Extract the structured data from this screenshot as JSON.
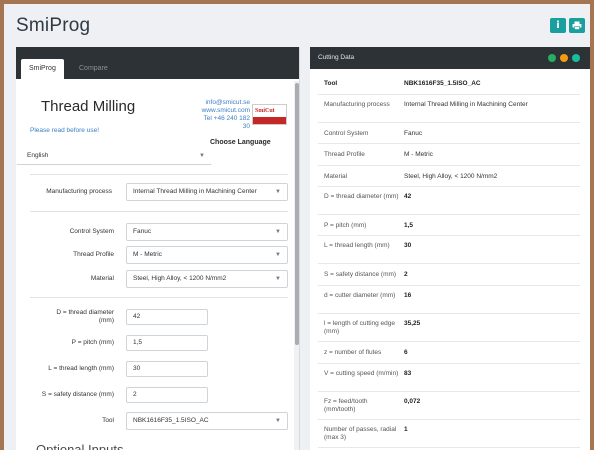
{
  "header": {
    "app_title": "SmiProg",
    "info_icon": "info-icon",
    "print_icon": "print-icon"
  },
  "left": {
    "tabs": [
      {
        "label": "SmiProg"
      },
      {
        "label": "Compare"
      }
    ],
    "heading": "Thread Milling",
    "read_link": "Please read before use!",
    "contact": {
      "email": "info@smicut.se",
      "web": "www.smicut.com",
      "tel1": "Tel +46 240 182",
      "tel2": "30"
    },
    "logo_text": "SmiCut",
    "choose_language": "Choose Language",
    "language": "English",
    "manufacturing_process": {
      "label": "Manufacturing process",
      "value": "Internal Thread Milling in Machining Center"
    },
    "control_system": {
      "label": "Control System",
      "value": "Fanuc"
    },
    "thread_profile": {
      "label": "Thread Profile",
      "value": "M - Metric"
    },
    "material": {
      "label": "Material",
      "value": "Steel, High Alloy, < 1200 N/mm2"
    },
    "diameter": {
      "label_1": "D = thread diameter",
      "label_2": "(mm)",
      "value": "42"
    },
    "pitch": {
      "label": "P = pitch (mm)",
      "value": "1,5"
    },
    "length": {
      "label": "L = thread length (mm)",
      "value": "30"
    },
    "safety": {
      "label": "S = safety distance (mm)",
      "value": "2"
    },
    "tool": {
      "label": "Tool",
      "value": "NBK1616F35_1.5ISO_AC"
    },
    "optional_heading": "Optional Inputs"
  },
  "right": {
    "header_title": "Cutting Data",
    "rows": [
      {
        "label": "Tool",
        "value": "NBK1616F35_1.5ISO_AC",
        "bold": true
      },
      {
        "label": "Manufacturing process",
        "value": "Internal Thread Milling in Machining Center",
        "bold": false
      },
      {
        "label": "Control System",
        "value": "Fanuc",
        "bold": false
      },
      {
        "label": "Thread Profile",
        "value": "M - Metric",
        "bold": false
      },
      {
        "label": "Material",
        "value": "Steel, High Alloy, < 1200 N/mm2",
        "bold": false
      },
      {
        "label": "D = thread diameter (mm)",
        "value": "42",
        "bold": true
      },
      {
        "label": "P = pitch (mm)",
        "value": "1,5",
        "bold": true
      },
      {
        "label": "L = thread length (mm)",
        "value": "30",
        "bold": true
      },
      {
        "label": "S = safety distance (mm)",
        "value": "2",
        "bold": true
      },
      {
        "label": "d = cutter diameter (mm)",
        "value": "16",
        "bold": true
      },
      {
        "label": "l = length of cutting edge (mm)",
        "value": "35,25",
        "bold": true
      },
      {
        "label": "z = number of flutes",
        "value": "6",
        "bold": true
      },
      {
        "label": "V = cutting speed (m/min)",
        "value": "83",
        "bold": true
      },
      {
        "label": "Fz = feed/tooth (mm/tooth)",
        "value": "0,072",
        "bold": true
      },
      {
        "label": "Number of passes, radial (max 3)",
        "value": "1",
        "bold": true
      }
    ]
  }
}
